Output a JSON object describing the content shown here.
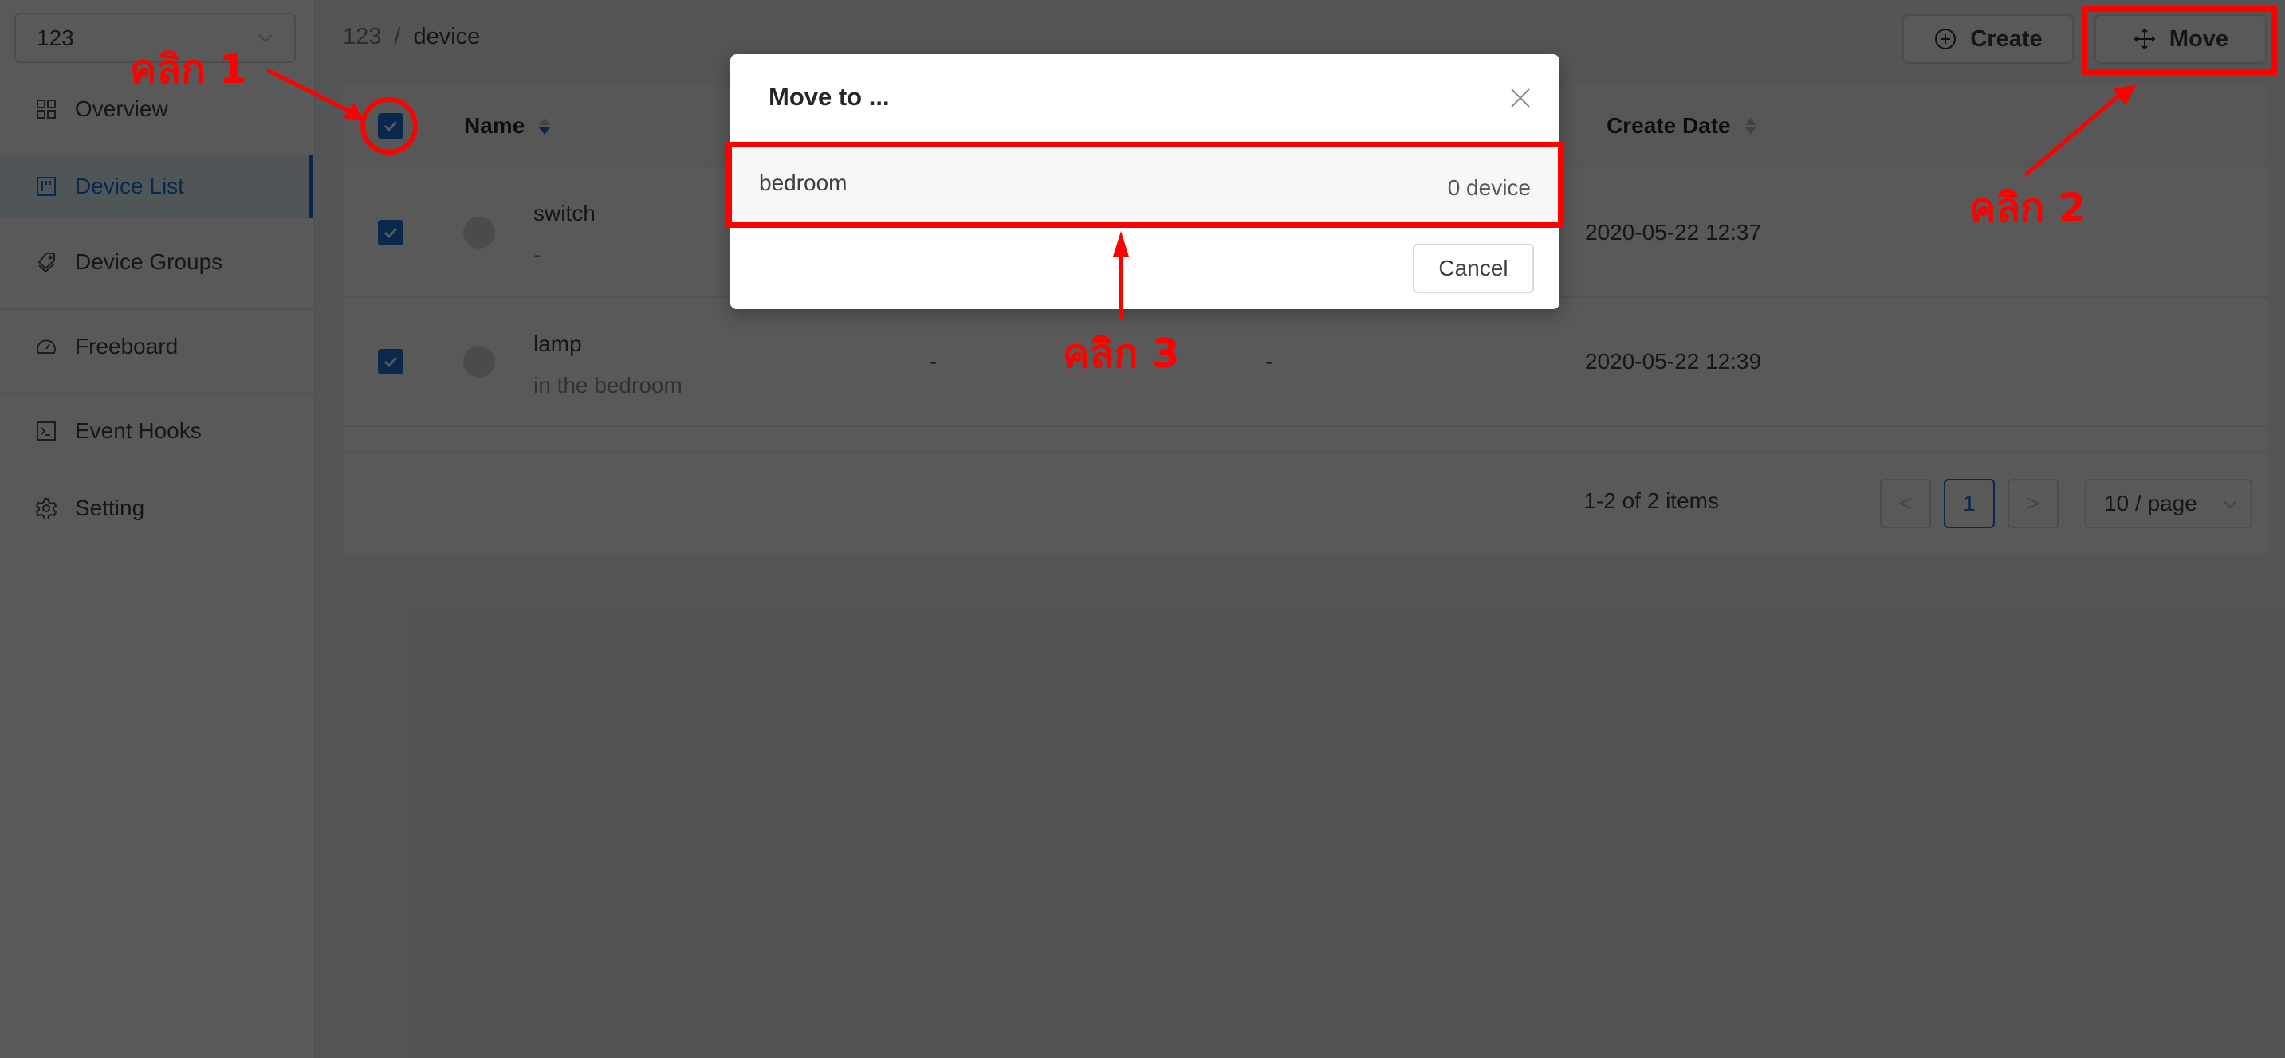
{
  "sidebar": {
    "project_select": {
      "value": "123"
    },
    "items": [
      {
        "label": "Overview",
        "icon": "grid-icon",
        "active": false
      },
      {
        "label": "Device List",
        "icon": "board-icon",
        "active": true
      },
      {
        "label": "Device Groups",
        "icon": "tags-icon",
        "active": false
      },
      {
        "label": "Freeboard",
        "icon": "dashboard-gauge-icon",
        "active": false
      },
      {
        "label": "Event Hooks",
        "icon": "terminal-icon",
        "active": false
      },
      {
        "label": "Setting",
        "icon": "gear-icon",
        "active": false
      }
    ]
  },
  "header": {
    "breadcrumb": [
      "123",
      "device"
    ],
    "breadcrumb_separator": "/",
    "create_label": "Create",
    "move_label": "Move"
  },
  "table": {
    "columns": [
      {
        "label": "Name",
        "sortable": true,
        "sort": "descend"
      },
      {
        "label": "Create Date",
        "sortable": true,
        "sort": "none"
      }
    ],
    "select_all_checked": true,
    "rows": [
      {
        "checked": true,
        "name": "switch",
        "description": "-",
        "col3": "",
        "col4": "",
        "create_date": "2020-05-22 12:37"
      },
      {
        "checked": true,
        "name": "lamp",
        "description": "in the bedroom",
        "col3": "-",
        "col4": "-",
        "create_date": "2020-05-22 12:39"
      }
    ]
  },
  "pagination": {
    "total_text": "1-2 of 2 items",
    "prev": "<",
    "current_page": "1",
    "next": ">",
    "page_size": "10 / page"
  },
  "modal": {
    "title": "Move to ...",
    "groups": [
      {
        "name": "bedroom",
        "count": "0 device"
      }
    ],
    "cancel_label": "Cancel"
  },
  "annotations": {
    "step1": "คลิก 1",
    "step2": "คลิก 2",
    "step3": "คลิก 3",
    "color": "#ff0000"
  },
  "colors": {
    "primary": "#1a73d9",
    "mask": "rgba(0,0,0,0.65)"
  }
}
